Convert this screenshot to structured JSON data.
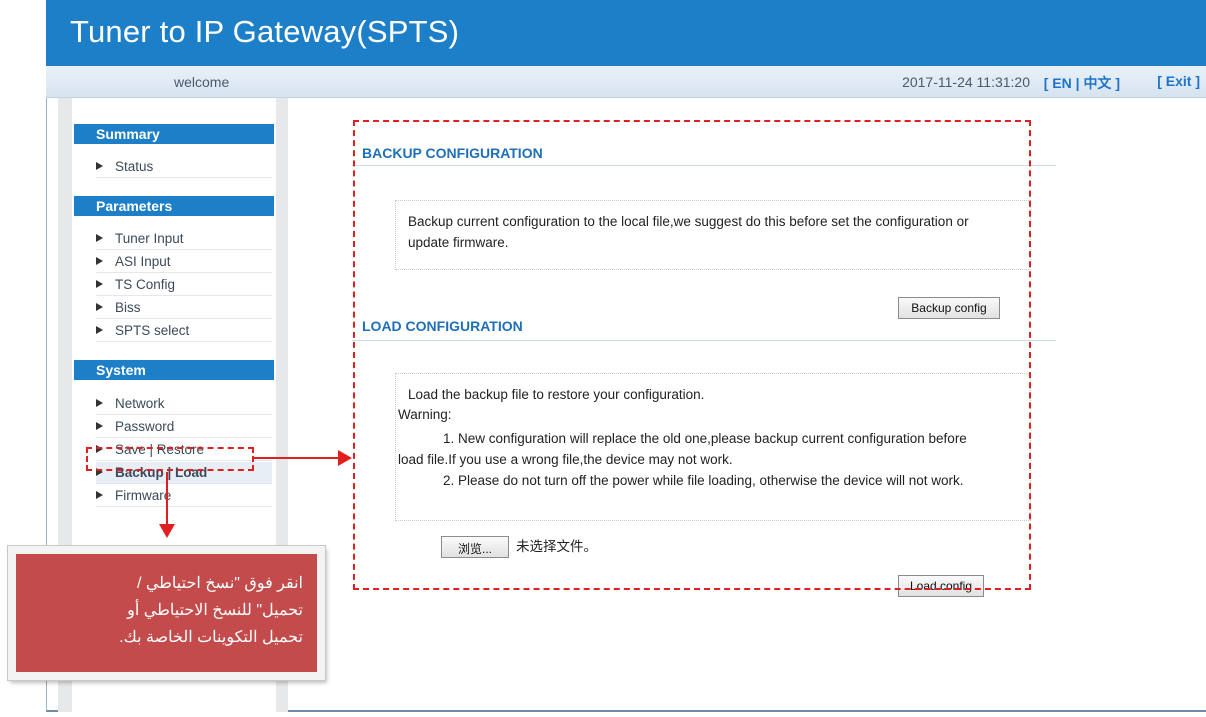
{
  "header": {
    "title": "Tuner to IP Gateway(SPTS)"
  },
  "topbar": {
    "welcome": "welcome",
    "datetime": "2017-11-24 11:31:20",
    "lang_open": "[ EN | ",
    "lang_zh": "中文",
    "lang_close": " ]",
    "exit": "[ Exit ]"
  },
  "sidebar": {
    "sections": [
      {
        "title": "Summary",
        "items": [
          "Status"
        ]
      },
      {
        "title": "Parameters",
        "items": [
          "Tuner Input",
          "ASI Input",
          "TS Config",
          "Biss",
          "SPTS select"
        ]
      },
      {
        "title": "System",
        "items": [
          "Network",
          "Password",
          "Save | Restore",
          "Backup | Load",
          "Firmware"
        ]
      }
    ]
  },
  "main": {
    "backup": {
      "title": "BACKUP CONFIGURATION",
      "description_line1": "Backup current configuration to the local file,we suggest do this before set the configuration or",
      "description_line2": "update firmware.",
      "button": "Backup config"
    },
    "load": {
      "title": "LOAD CONFIGURATION",
      "line1": "Load the backup file to restore your configuration.",
      "warning": "Warning:",
      "item1a": "1. New configuration will replace the old one,please backup current configuration before",
      "item1b": "load file.If you use a wrong file,the device may not work.",
      "item2": "2. Please do not turn off the power while file loading, otherwise the device will not work.",
      "browse_button": "浏览...",
      "no_file": "未选择文件。",
      "button": "Load config"
    }
  },
  "callout": {
    "line1": "انقر فوق \"نسخ احتياطي /",
    "line2": "تحميل\" للنسخ الاحتياطي أو",
    "line3": "تحميل التكوينات الخاصة بك."
  },
  "colors": {
    "header": "#1d7fc8",
    "annotation": "#e0201e",
    "callout": "#c44b4b"
  }
}
